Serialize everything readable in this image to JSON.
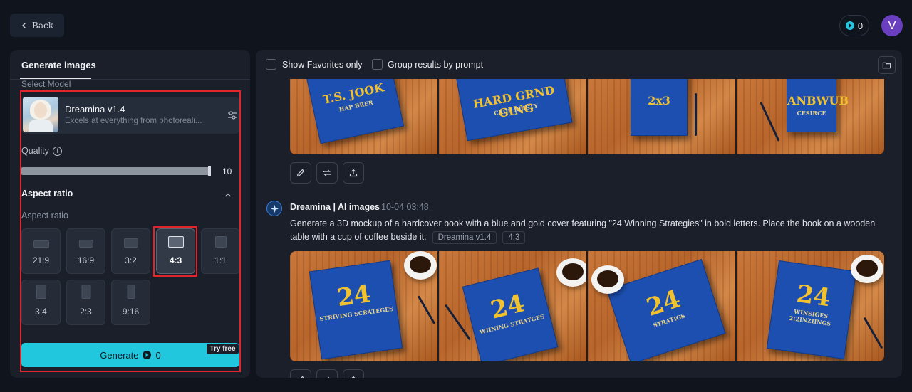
{
  "header": {
    "back_label": "Back",
    "credits": "0",
    "avatar_letter": "V"
  },
  "left": {
    "tab": "Generate images",
    "select_model_label": "Select Model",
    "model": {
      "name": "Dreamina v1.4",
      "description": "Excels at everything from photoreali..."
    },
    "quality": {
      "label": "Quality",
      "value": "10",
      "level": 1.0
    },
    "aspect": {
      "heading": "Aspect ratio",
      "sub_label": "Aspect ratio",
      "options": [
        "21:9",
        "16:9",
        "3:2",
        "4:3",
        "1:1",
        "3:4",
        "2:3",
        "9:16"
      ],
      "selected": "4:3"
    },
    "generate": {
      "label": "Generate",
      "credits": "0",
      "badge": "Try free"
    }
  },
  "right": {
    "show_favorites_label": "Show Favorites only",
    "group_results_label": "Group results by prompt",
    "result": {
      "author": "Dreamina | AI images",
      "time": "10-04  03:48",
      "prompt": "Generate a 3D mockup of a hardcover book with a blue and gold cover featuring \"24 Winning Strategies\" in bold letters. Place the book on a wooden table with a cup of coffee beside it.",
      "model_tag": "Dreamina v1.4",
      "ratio_tag": "4:3"
    },
    "top_images": [
      {
        "title": "T.S. JOOK",
        "sub": "HAP BRER"
      },
      {
        "title": "HARD GRND GING",
        "sub": "CADE RIASTY"
      },
      {
        "title": "2x3",
        "sub": ""
      },
      {
        "title": "ANBWUB",
        "sub": "CESIRCE"
      }
    ],
    "result_images": [
      {
        "title": "24",
        "sub": "STRIVING SCRATEGES"
      },
      {
        "title": "24",
        "sub": "WIINING STRATGES"
      },
      {
        "title": "24",
        "sub": "STRATIGS"
      },
      {
        "title": "24",
        "sub": "WINSIGES 2!2INZIINGS"
      }
    ]
  },
  "colors": {
    "accent": "#21c7dc",
    "highlight_box": "#e0262c",
    "avatar": "#6a3fbf"
  }
}
